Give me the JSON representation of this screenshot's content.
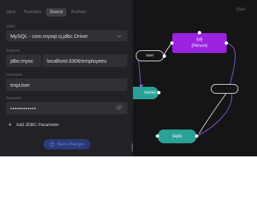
{
  "tabs": [
    {
      "label": "Input"
    },
    {
      "label": "Functions"
    },
    {
      "label": "Source",
      "active": true
    },
    {
      "label": "Prefixes"
    }
  ],
  "query_tab": "Quer",
  "form": {
    "jdbc_label": "JDBC",
    "driver_value": "MySQL - com.mysql.cj.jdbc.Driver",
    "endpoint_label": "Endpoint",
    "endpoint_prefix": "jdbc:mysc",
    "endpoint_value": "localhost:3306/employees",
    "username_label": "Username",
    "username_value": "tmpUser",
    "password_label": "Password",
    "password_value": "••••••••••••",
    "add_param_label": "Add JDBC Parameter",
    "save_label": "Save Changes"
  },
  "graph": {
    "person_node": {
      "line1": "{id}",
      "line2": "{Person}"
    },
    "name_node": "name}",
    "age_node": "{age}",
    "edge_label_left": "label",
    "edge_label_right": ""
  },
  "colors": {
    "panel_bg": "#222226",
    "canvas_bg": "#151517",
    "person_node": "#9b23e0",
    "literal_node": "#2aa197",
    "edge": "#9a55e0",
    "save_button_bg": "#2a3a78",
    "save_button_text": "#6f86d6"
  }
}
